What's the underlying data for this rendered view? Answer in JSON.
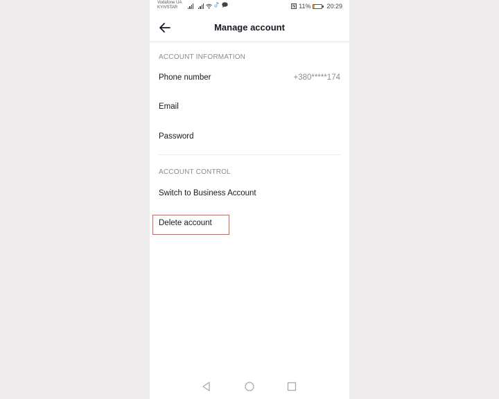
{
  "status_bar": {
    "carrier_1": "Vodafone UA",
    "carrier_2": "KYIVSTAR",
    "battery_percent": "11%",
    "battery_level": 0.11,
    "battery_color": "#f5a623",
    "time": "20:29",
    "icons": [
      "signal-icon",
      "signal-icon",
      "wifi-icon",
      "app-notification-icon",
      "chat-icon",
      "nfc-icon",
      "battery-icon"
    ]
  },
  "header": {
    "back_icon": "arrow-left-icon",
    "title": "Manage account"
  },
  "sections": [
    {
      "label": "ACCOUNT INFORMATION",
      "items": [
        {
          "label": "Phone number",
          "value": "+380*****174"
        },
        {
          "label": "Email",
          "value": ""
        },
        {
          "label": "Password",
          "value": ""
        }
      ]
    },
    {
      "label": "ACCOUNT CONTROL",
      "items": [
        {
          "label": "Switch to Business Account"
        },
        {
          "label": "Delete account",
          "highlighted": true
        }
      ]
    }
  ],
  "highlight_color": "#e1614c",
  "nav_bar": {
    "buttons": [
      "back-triangle-icon",
      "home-circle-icon",
      "recents-square-icon"
    ]
  }
}
